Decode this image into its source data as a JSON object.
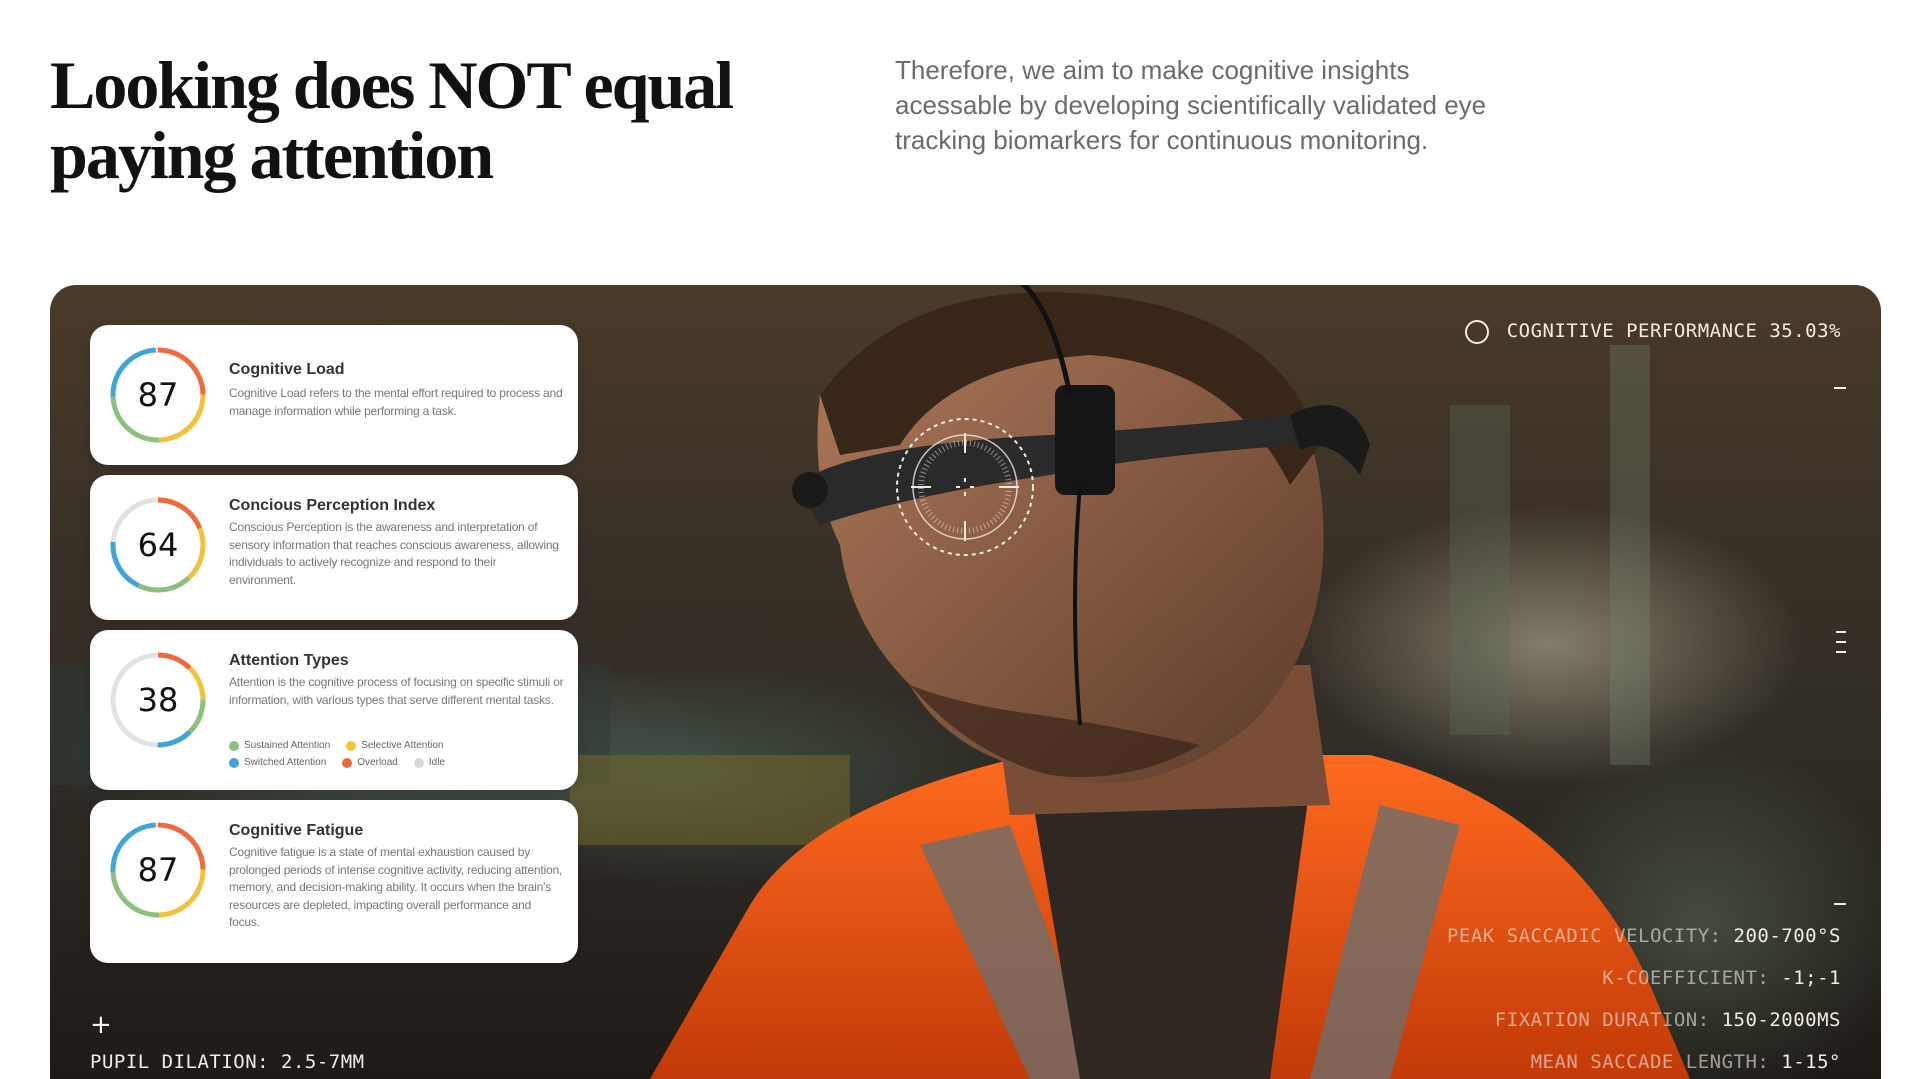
{
  "header": {
    "title_line1": "Looking does NOT equal",
    "title_line2": "paying attention",
    "intro": "Therefore, we aim to make cognitive insights acessable by developing scientifically validated eye tracking biomarkers for continuous monitoring."
  },
  "cards": [
    {
      "value": "87",
      "title": "Cognitive Load",
      "description": "Cognitive Load refers to the mental effort required to process and manage information while performing a task."
    },
    {
      "value": "64",
      "title": "Concious Perception Index",
      "description": "Conscious Perception is the awareness and interpretation of sensory information that reaches conscious awareness, allowing individuals to actively recognize and respond to their environment."
    },
    {
      "value": "38",
      "title": "Attention Types",
      "description": "Attention is the cognitive process of focusing on specific stimuli or information, with various types that serve different mental tasks.",
      "legend": [
        {
          "label": "Sustained Attention",
          "color": "#8dbf7d"
        },
        {
          "label": "Selective Attention",
          "color": "#f2c23c"
        },
        {
          "label": "Switched Attention",
          "color": "#3ea5d9"
        },
        {
          "label": "Overload",
          "color": "#ef6a3c"
        },
        {
          "label": "Idle",
          "color": "#d8d8d8"
        }
      ]
    },
    {
      "value": "87",
      "title": "Cognitive Fatigue",
      "description": "Cognitive fatigue is a state of mental exhaustion caused by prolonged periods of intense cognitive activity, reducing attention, memory, and decision-making ability. It occurs when the brain's resources are depleted, impacting overall performance and focus."
    }
  ],
  "hud": {
    "performance": "COGNITIVE PERFORMANCE 35.03%",
    "pupil_dilation": "PUPIL DILATION: 2.5-7MM",
    "metrics": [
      {
        "label": "PEAK SACCADIC VELOCITY:",
        "value": "200-700°S"
      },
      {
        "label": "K-COEFFICIENT:",
        "value": "-1;-1"
      },
      {
        "label": "FIXATION DURATION:",
        "value": "150-2000MS"
      },
      {
        "label": "MEAN SACCADE LENGTH:",
        "value": "1-15°"
      }
    ]
  },
  "colors": {
    "accent_orange": "#ef6a3c",
    "accent_yellow": "#f2c23c",
    "accent_blue": "#3ea5d9",
    "accent_green": "#8dbf7d"
  }
}
